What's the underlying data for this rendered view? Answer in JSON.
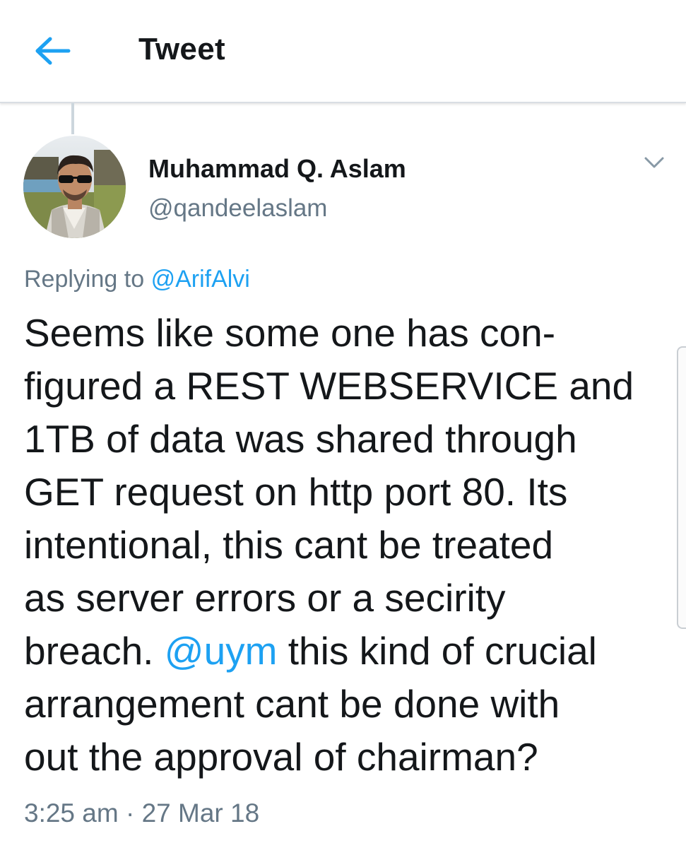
{
  "header": {
    "back_icon": "arrow-left-icon",
    "title": "Tweet"
  },
  "colors": {
    "accent": "#1da1f2",
    "secondary_text": "#657786",
    "primary_text": "#14171a"
  },
  "tweet": {
    "author": {
      "display_name": "Muhammad Q. Aslam",
      "handle": "@qandeelaslam",
      "avatar_icon": "profile-photo"
    },
    "menu_icon": "chevron-down-icon",
    "replying_to_label": "Replying to",
    "replying_to_handle": "@ArifAlvi",
    "text": {
      "line1": "Seems like some one has con-",
      "line2": "figured a REST WEBSERVICE and",
      "line3": "1TB of data was shared through",
      "line4": "GET request on http port 80. Its",
      "line5": "intentional, this cant be treated",
      "line6": "as server errors or a secirity",
      "line7_before": "breach. ",
      "line7_mention": "@uym",
      "line7_after": " this kind of crucial",
      "line8": "arrangement cant be done with",
      "line9": "out the approval of chairman?"
    },
    "time": "3:25 am",
    "separator": "·",
    "date": "27 Mar 18"
  }
}
